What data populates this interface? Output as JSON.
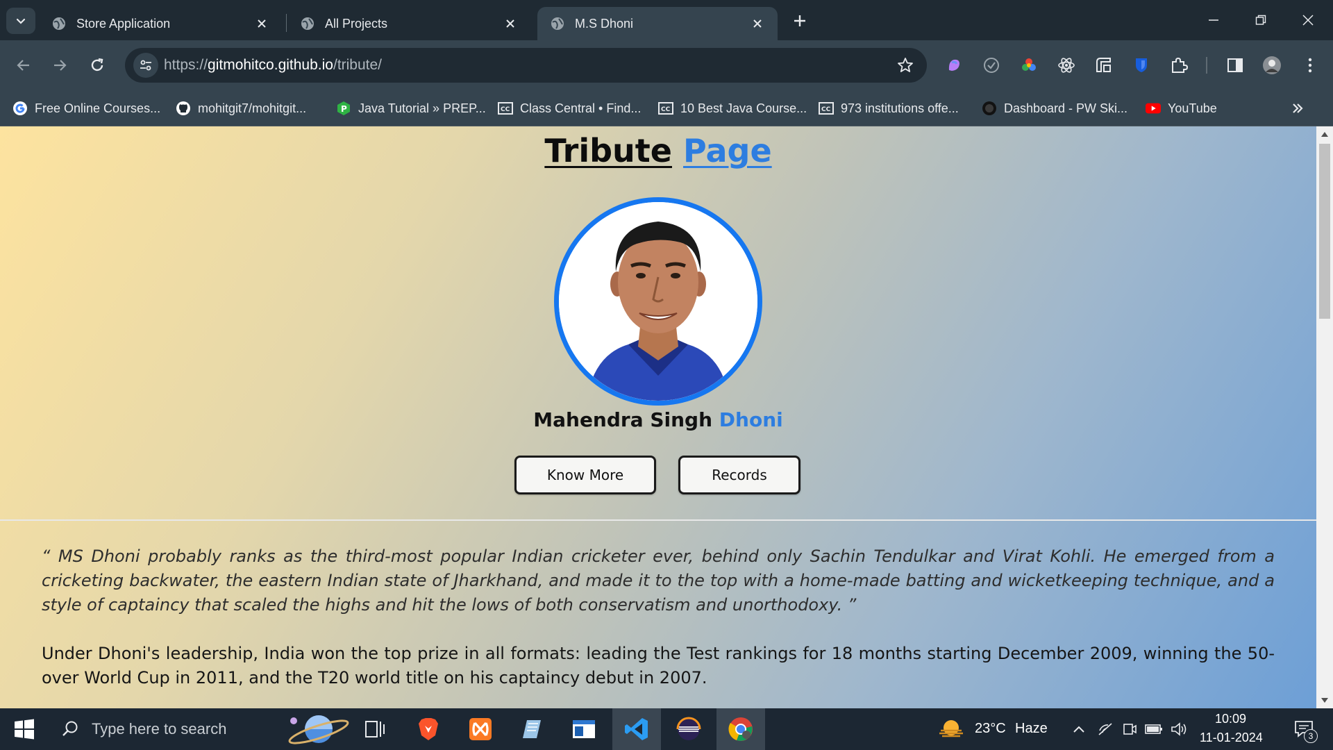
{
  "tabs": [
    {
      "title": "Store Application",
      "active": false
    },
    {
      "title": "All Projects",
      "active": false
    },
    {
      "title": "M.S Dhoni",
      "active": true
    }
  ],
  "address_bar": {
    "scheme": "https://",
    "host": "gitmohitco.github.io",
    "path": "/tribute/"
  },
  "bookmarks": [
    {
      "label": "Free Online Courses...",
      "icon": "google-icon"
    },
    {
      "label": "mohitgit7/mohitgit...",
      "icon": "github-icon"
    },
    {
      "label": "Java Tutorial » PREP...",
      "icon": "prepinsta-icon"
    },
    {
      "label": "Class Central • Find...",
      "icon": "class-central-icon"
    },
    {
      "label": "10 Best Java Course...",
      "icon": "class-central-icon"
    },
    {
      "label": "973 institutions offe...",
      "icon": "class-central-icon"
    },
    {
      "label": "Dashboard - PW Ski...",
      "icon": "pw-skills-icon"
    },
    {
      "label": "YouTube",
      "icon": "youtube-icon"
    }
  ],
  "page": {
    "title_part1": "Tribute",
    "title_part2": "Page",
    "name_part1": "Mahendra Singh",
    "name_part2": "Dhoni",
    "buttons": {
      "know_more": "Know More",
      "records": "Records"
    },
    "quote": "“ MS Dhoni probably ranks as the third-most popular Indian cricketer ever, behind only Sachin Tendulkar and Virat Kohli. He emerged from a cricketing backwater, the eastern Indian state of Jharkhand, and made it to the top with a home-made batting and wicketkeeping technique, and a style of captaincy that scaled the highs and hit the lows of both conservatism and unorthodoxy. ”",
    "paragraph": "Under Dhoni's leadership, India won the top prize in all formats: leading the Test rankings for 18 months starting December 2009, winning the 50-over World Cup in 2011, and the T20 world title on his captaincy debut in 2007."
  },
  "taskbar": {
    "search_placeholder": "Type here to search",
    "weather_temp": "23°C",
    "weather_text": "Haze",
    "time": "10:09",
    "date": "11-01-2024",
    "notification_count": "3"
  },
  "colors": {
    "accent_blue": "#2d7de0",
    "portrait_border": "#1677f0",
    "tab_active": "#35444f",
    "tabstrip": "#1f2a33"
  }
}
